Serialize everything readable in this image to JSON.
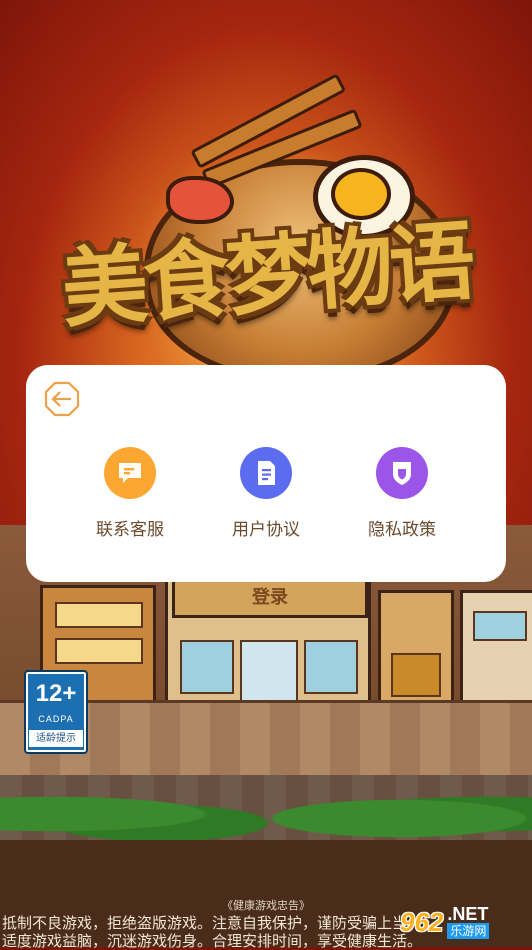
{
  "background": {
    "game_title": "美食梦物语",
    "building_sign": "登录"
  },
  "age_rating": {
    "number": "12+",
    "org": "CADPA",
    "hint": "适龄提示"
  },
  "health_notice": {
    "title": "《健康游戏忠告》",
    "line1": "抵制不良游戏，拒绝盗版游戏。注意自我保护，谨防受骗上当。",
    "line2": "适度游戏益脑，沉迷游戏伤身。合理安排时间，享受健康生活。"
  },
  "watermark": {
    "number": "962",
    "net": ".NET",
    "cn": "乐游网"
  },
  "dialog": {
    "back_icon": "back-arrow-icon",
    "items": [
      {
        "label": "联系客服",
        "icon": "customer-service-icon",
        "color": "#fba731"
      },
      {
        "label": "用户协议",
        "icon": "document-icon",
        "color": "#5b6cf0"
      },
      {
        "label": "隐私政策",
        "icon": "shield-icon",
        "color": "#9b55e8"
      }
    ],
    "accent_color": "#e8a24a"
  },
  "colors": {
    "overlay": "rgba(0,0,0,0.0)",
    "dialog_bg": "#ffffff"
  }
}
